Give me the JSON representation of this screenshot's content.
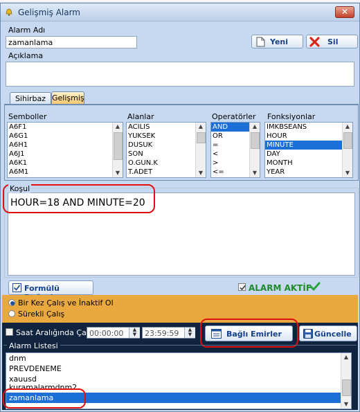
{
  "window": {
    "title": "Gelişmiş Alarm",
    "close_glyph": "✕"
  },
  "alarm_name": {
    "label": "Alarm Adı",
    "value": "zamanlama"
  },
  "description": {
    "label": "Açıklama",
    "value": ""
  },
  "buttons": {
    "new": "Yeni",
    "delete": "Sil",
    "verify": "Formülü Doğrula",
    "linked_orders": "Bağlı Emirler",
    "update": "Güncelle"
  },
  "tabs": [
    {
      "label": "Sihirbaz"
    },
    {
      "label": "Gelişmiş"
    }
  ],
  "symbols": {
    "header": "Semboller",
    "items": [
      "A6F1",
      "A6G1",
      "A6H1",
      "A6J1",
      "A6K1",
      "A6M1"
    ]
  },
  "fields": {
    "header": "Alanlar",
    "items": [
      "ACILIS",
      "YUKSEK",
      "DUSUK",
      "SON",
      "O.GUN.K",
      "T.ADET"
    ]
  },
  "operators": {
    "header": "Operatörler",
    "items": [
      "AND",
      "OR",
      "=",
      "<",
      ">",
      "<="
    ],
    "selected": "AND"
  },
  "functions": {
    "header": "Fonksiyonlar",
    "items": [
      "IMKBSEANS",
      "HOUR",
      "MINUTE",
      "DAY",
      "MONTH",
      "YEAR"
    ],
    "selected": "MINUTE"
  },
  "condition": {
    "label": "Koşul",
    "value": "HOUR=18 AND MINUTE=20"
  },
  "alarm_active": {
    "label": "ALARM AKTİF",
    "checked": true
  },
  "run_mode": {
    "options": [
      {
        "label": "Bir Kez Çalış ve İnaktif Ol",
        "checked": true
      },
      {
        "label": "Sürekli Çalış",
        "checked": false
      }
    ]
  },
  "time_range": {
    "label": "Saat Aralığında Çalış",
    "checked": false,
    "start": "00:00:00",
    "end": "23:59:59"
  },
  "alarm_list": {
    "label": "Alarm Listesi",
    "items": [
      "dnm",
      "PREVDENEME",
      "xauusd",
      "kuramalarmdnm2",
      "zamanlama"
    ],
    "selected": "zamanlama"
  },
  "colors": {
    "highlight": "#e01010",
    "selection": "#1c6fd6",
    "run_mode_bg": "#e9a93e",
    "alarm_list_bg": "#10233f"
  }
}
